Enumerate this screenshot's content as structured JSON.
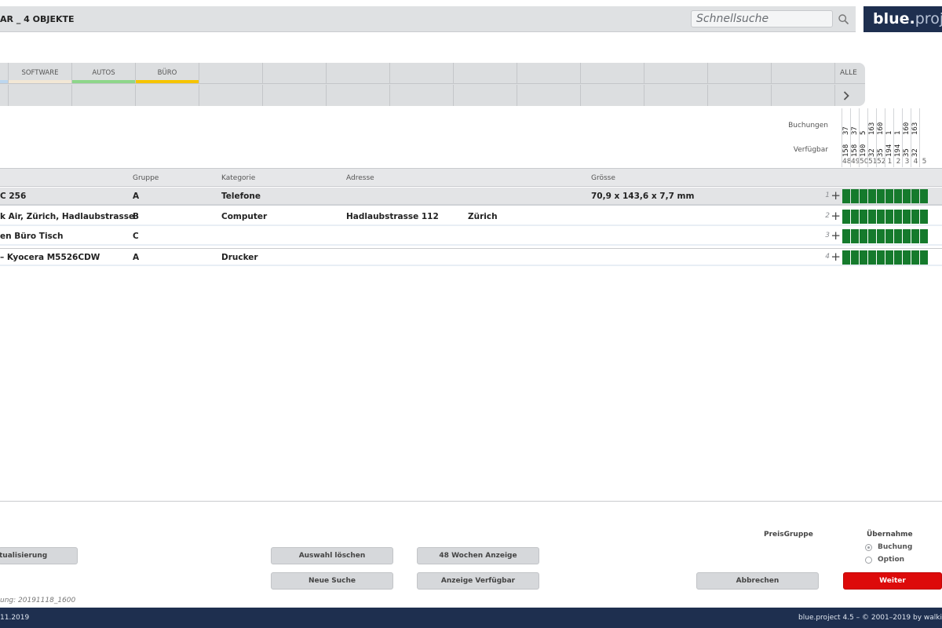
{
  "header": {
    "title": "AR _ 4 OBJEKTE",
    "search_placeholder": "Schnellsuche",
    "logo_bold": "blue.",
    "logo_light": "proj"
  },
  "tabs": {
    "row1": [
      {
        "label": "",
        "color": "#bcd6ee"
      },
      {
        "label": "SOFTWARE",
        "color": "#f2e7d5"
      },
      {
        "label": "AUTOS",
        "color": "#8ed68a"
      },
      {
        "label": "BÜRO",
        "color": "#f6c400"
      },
      {
        "label": "",
        "color": ""
      },
      {
        "label": "",
        "color": ""
      },
      {
        "label": "",
        "color": ""
      },
      {
        "label": "",
        "color": ""
      },
      {
        "label": "",
        "color": ""
      },
      {
        "label": "",
        "color": ""
      },
      {
        "label": "",
        "color": ""
      },
      {
        "label": "",
        "color": ""
      },
      {
        "label": "",
        "color": ""
      },
      {
        "label": "",
        "color": ""
      }
    ],
    "alle": "ALLE"
  },
  "calendar": {
    "buchungen_label": "Buchungen",
    "verfuegbar_label": "Verfügbar",
    "weeks": [
      "48",
      "49",
      "50",
      "51",
      "52",
      "1",
      "2",
      "3",
      "4",
      "5"
    ],
    "buchungen": [
      "37",
      "37",
      "5",
      "163",
      "160",
      "1",
      "1",
      "160",
      "163",
      ""
    ],
    "verfuegbar": [
      "158",
      "158",
      "190",
      "32",
      "35",
      "194",
      "194",
      "35",
      "32",
      ""
    ]
  },
  "table": {
    "headers": {
      "gruppe": "Gruppe",
      "kategorie": "Kategorie",
      "adresse": "Adresse",
      "groesse": "Grösse"
    },
    "rows": [
      {
        "name": "C 256",
        "gruppe": "A",
        "kategorie": "Telefone",
        "adresse": "",
        "ort": "",
        "groesse": "70,9 x 143,6 x 7,7 mm",
        "num": "1"
      },
      {
        "name": "k Air, Zürich, Hadlaubstrasse",
        "gruppe": "B",
        "kategorie": "Computer",
        "adresse": "Hadlaubstrasse 112",
        "ort": "Zürich",
        "groesse": "",
        "num": "2"
      },
      {
        "name": "en Büro Tisch",
        "gruppe": "C",
        "kategorie": "",
        "adresse": "",
        "ort": "",
        "groesse": "",
        "num": "3"
      },
      {
        "name": "– Kyocera M5526CDW",
        "gruppe": "A",
        "kategorie": "Drucker",
        "adresse": "",
        "ort": "",
        "groesse": "",
        "num": "4"
      }
    ],
    "add_symbol": "+",
    "cell_color": "#157a2c"
  },
  "footer": {
    "aktualisierung": "tualisierung",
    "auswahl_loeschen": "Auswahl löschen",
    "wochen_anzeige": "48 Wochen Anzeige",
    "neue_suche": "Neue Suche",
    "anzeige_verfuegbar": "Anzeige Verfügbar",
    "abbrechen": "Abbrechen",
    "weiter": "Weiter",
    "preisgruppe": "PreisGruppe",
    "uebernahme": "Übernahme",
    "opt_buchung": "Buchung",
    "opt_option": "Option",
    "version_note": "ung: 20191118_1600"
  },
  "status": {
    "left": "11.2019",
    "right": "blue.project 4.5 – © 2001–2019 by walki"
  }
}
